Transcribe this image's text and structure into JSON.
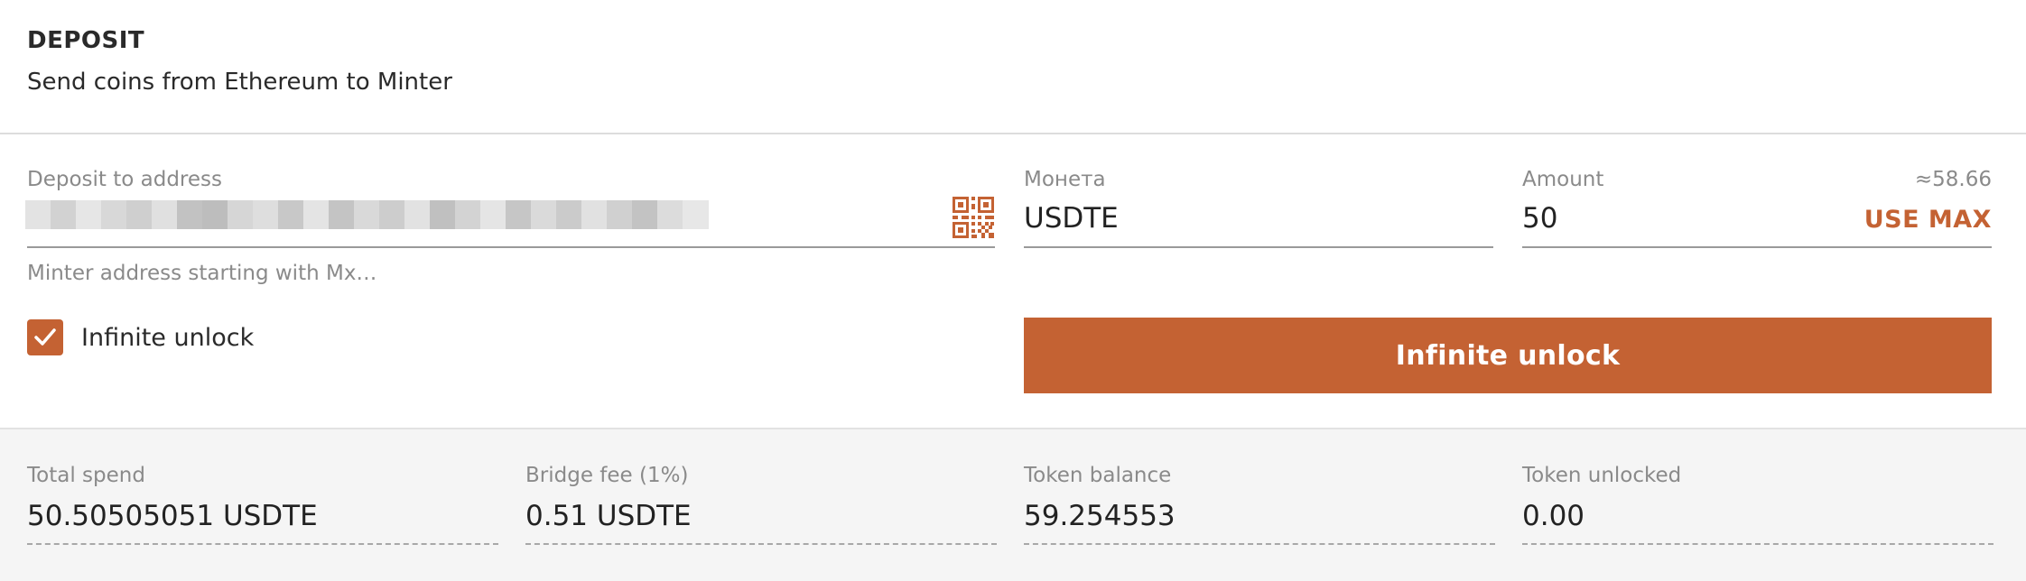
{
  "header": {
    "title": "DEPOSIT",
    "subtitle": "Send coins from Ethereum to Minter"
  },
  "address_field": {
    "label": "Deposit to address",
    "hint": "Minter address starting with Mx…",
    "qr_icon": "qr-code-icon"
  },
  "checkbox": {
    "label": "Infinite unlock",
    "checked": true,
    "icon": "checkmark-icon"
  },
  "coin_field": {
    "label": "Монета",
    "value": "USDTE"
  },
  "amount_field": {
    "label": "Amount",
    "approx": "≈58.66",
    "value": "50",
    "max_label": "USE MAX"
  },
  "primary_button": {
    "label": "Infinite unlock"
  },
  "summary": [
    {
      "label": "Total spend",
      "value": "50.50505051 USDTE"
    },
    {
      "label": "Bridge fee (1%)",
      "value": "0.51 USDTE"
    },
    {
      "label": "Token balance",
      "value": "59.254553"
    },
    {
      "label": "Token unlocked",
      "value": "0.00"
    }
  ],
  "colors": {
    "accent": "#c46233",
    "label_gray": "#8a8a8a",
    "summary_bg": "#f5f5f5"
  }
}
